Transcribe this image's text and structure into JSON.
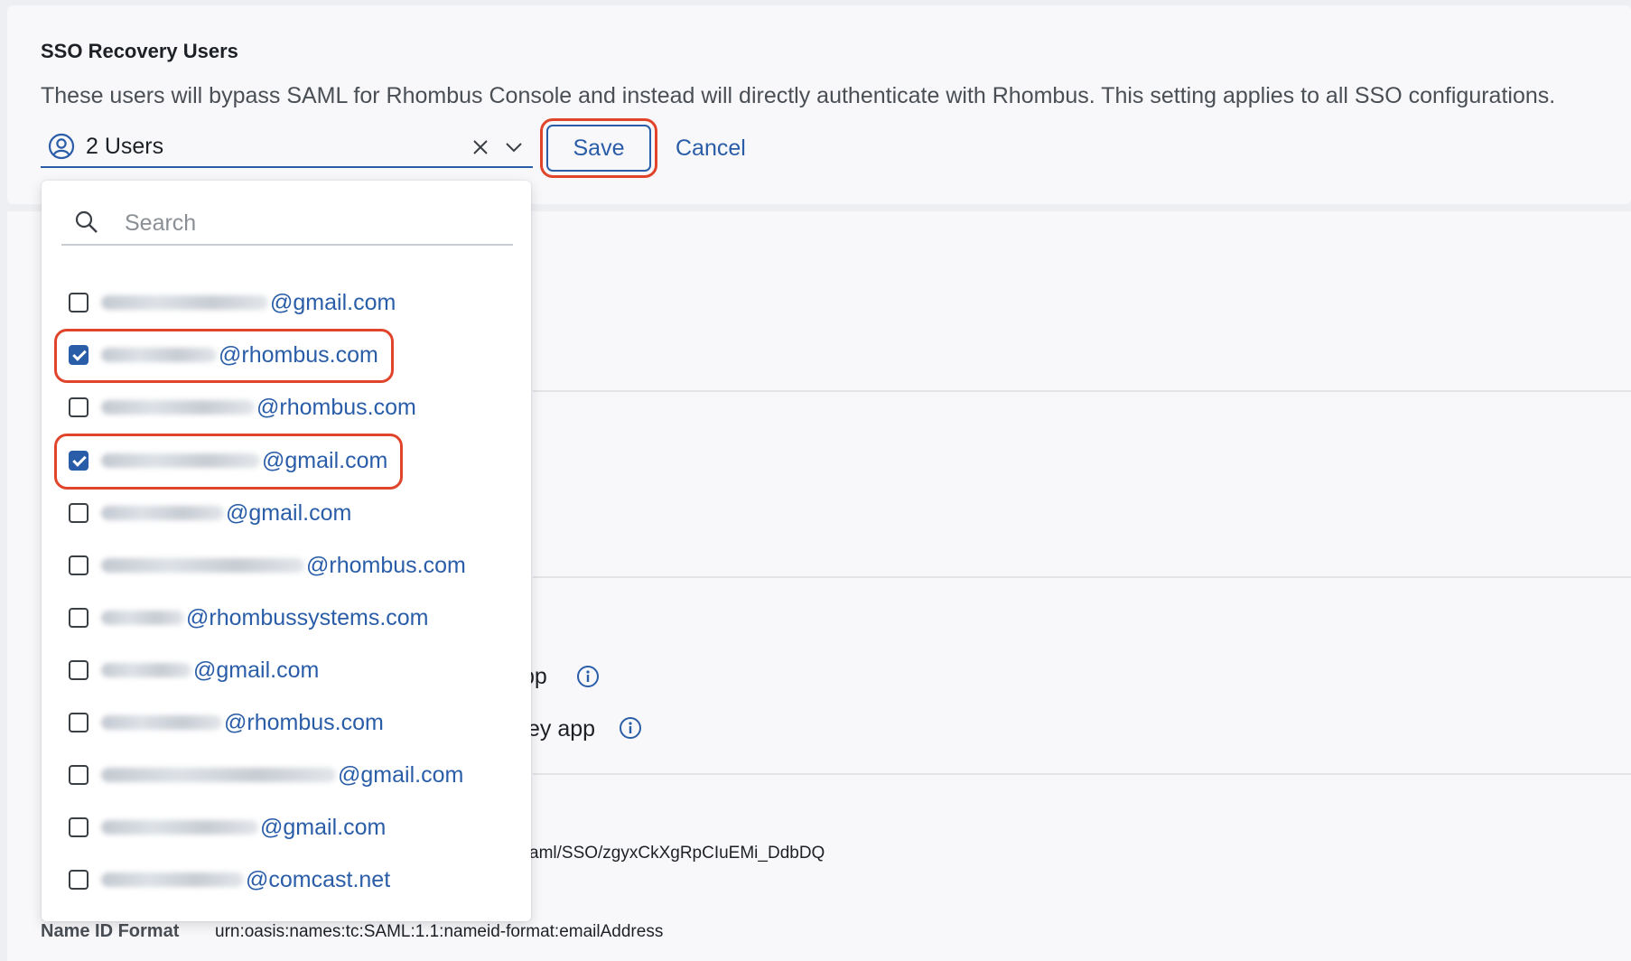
{
  "sso_recovery": {
    "title": "SSO Recovery Users",
    "description": "These users will bypass SAML for Rhombus Console and instead will directly authenticate with Rhombus. This setting applies to all SSO configurations.",
    "selected_count_label": "2 Users",
    "save_label": "Save",
    "cancel_label": "Cancel"
  },
  "dropdown": {
    "search_placeholder": "Search",
    "options": [
      {
        "domain": "@gmail.com",
        "checked": false
      },
      {
        "domain": "@rhombus.com",
        "checked": true
      },
      {
        "domain": "@rhombus.com",
        "checked": false
      },
      {
        "domain": "@gmail.com",
        "checked": true
      },
      {
        "domain": "@gmail.com",
        "checked": false
      },
      {
        "domain": "@rhombus.com",
        "checked": false
      },
      {
        "domain": "@rhombussystems.com",
        "checked": false
      },
      {
        "domain": "@gmail.com",
        "checked": false
      },
      {
        "domain": "@rhombus.com",
        "checked": false
      },
      {
        "domain": "@gmail.com",
        "checked": false
      },
      {
        "domain": "@gmail.com",
        "checked": false
      },
      {
        "domain": "@comcast.net",
        "checked": false
      }
    ]
  },
  "background": {
    "app_text_1": "pp",
    "app_text_2": "ey app",
    "sso_url_fragment": "aml/SSO/zgyxCkXgRpCIuEMi_DdbDQ",
    "name_id_label": "Name ID Format",
    "name_id_value": "urn:oasis:names:tc:SAML:1.1:nameid-format:emailAddress"
  },
  "colors": {
    "accent": "#2a5da8",
    "highlight": "#e0452b"
  }
}
